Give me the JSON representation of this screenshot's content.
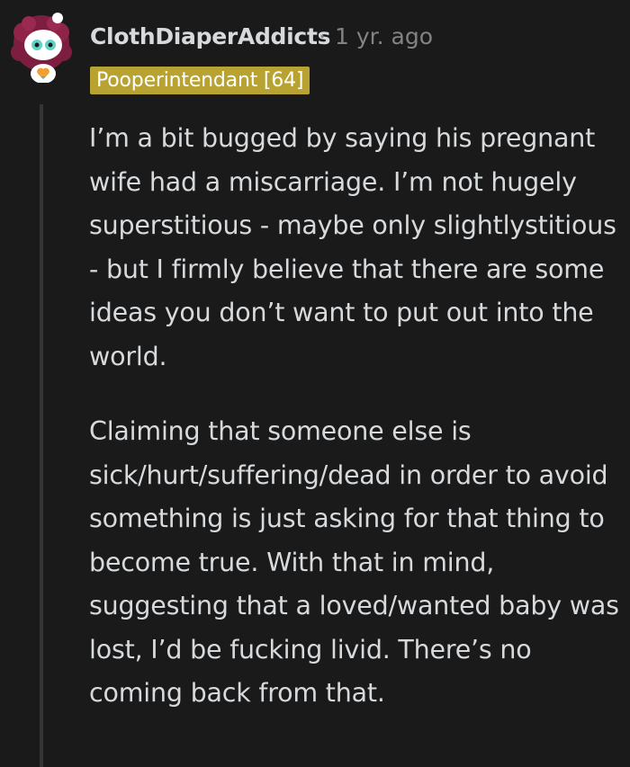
{
  "comment": {
    "author": "ClothDiaperAddicts",
    "separator": "·",
    "timestamp": "1 yr. ago",
    "flair": "Pooperintendant [64]",
    "paragraphs": [
      "I’m a bit bugged by saying his pregnant wife had a miscarriage. I’m not hugely superstitious - maybe only slightlystitious - but I firmly believe that there are some ideas you don’t want to put out into the world.",
      "Claiming that someone else is sick/hurt/suffering/dead in order to avoid something is just asking for that thing to become true. With that in mind, suggesting that a loved/wanted baby was lost, I’d be fucking livid. There’s no coming back from that."
    ]
  },
  "colors": {
    "background": "#1a1a1b",
    "text": "#d7dadc",
    "muted": "#818384",
    "flair_bg": "#b8a232",
    "thread_line": "#343536"
  },
  "icons": {
    "avatar": "snoo-avatar-icon"
  }
}
